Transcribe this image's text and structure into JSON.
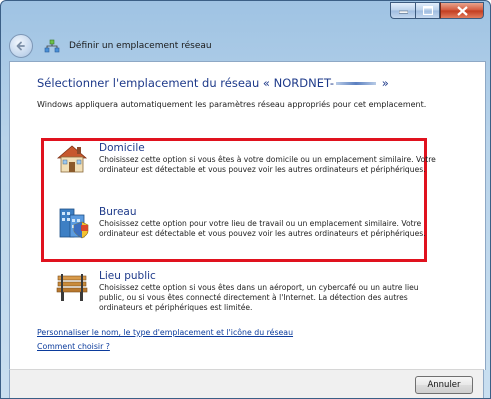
{
  "window": {
    "title": "Définir un emplacement réseau",
    "caption_buttons": [
      "minimize",
      "maximize",
      "close"
    ]
  },
  "heading": {
    "prefix": "Sélectionner l'emplacement du réseau « NORDNET-",
    "suffix": " »"
  },
  "description": "Windows appliquera automatiquement les paramètres réseau appropriés pour cet emplacement.",
  "options": [
    {
      "icon": "home-icon",
      "title": "Domicile",
      "body": "Choisissez cette option si vous êtes à votre domicile ou un emplacement similaire. Votre ordinateur est détectable et vous pouvez voir les autres ordinateurs et périphériques."
    },
    {
      "icon": "office-building-icon",
      "title": "Bureau",
      "body": "Choisissez cette option pour votre lieu de travail ou un emplacement similaire. Votre ordinateur est détectable et vous pouvez voir les autres ordinateurs et périphériques."
    },
    {
      "icon": "park-bench-icon",
      "title": "Lieu public",
      "body": "Choisissez cette option si vous êtes dans un aéroport, un cybercafé ou un autre lieu public, ou si vous êtes connecté directement à l'Internet. La détection des autres ordinateurs et périphériques est limitée."
    }
  ],
  "links": {
    "customize": "Personnaliser le nom, le type d'emplacement et l'icône du réseau",
    "how_to_choose": "Comment choisir ?"
  },
  "footer": {
    "cancel_label": "Annuler"
  },
  "colors": {
    "highlight_border": "#e0121e",
    "heading": "#1e3a8a",
    "link": "#0b3b9c"
  }
}
